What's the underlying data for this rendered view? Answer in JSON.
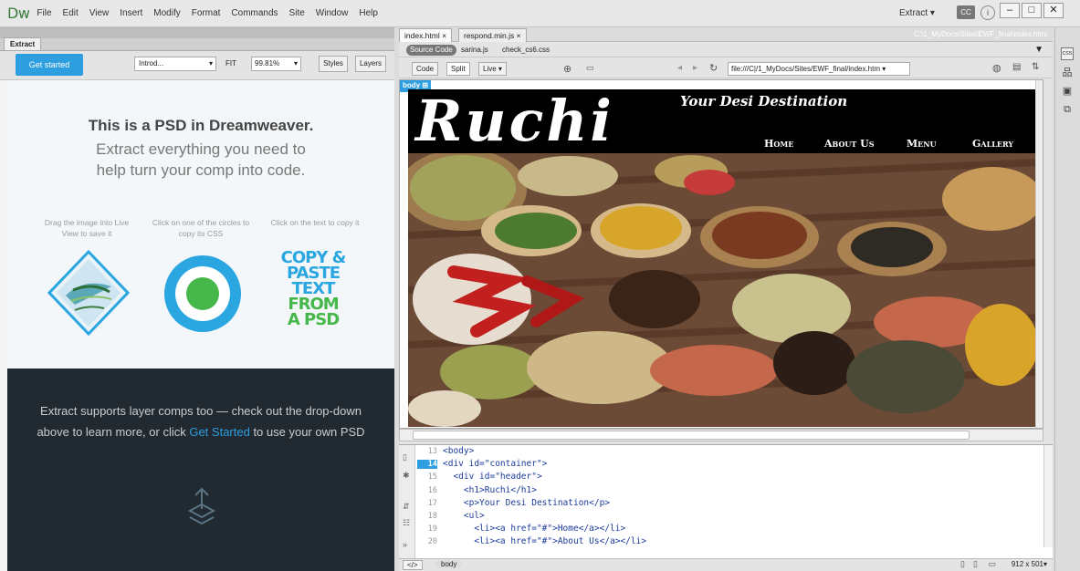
{
  "app": {
    "logo": "Dw"
  },
  "menu": [
    "File",
    "Edit",
    "View",
    "Insert",
    "Modify",
    "Format",
    "Commands",
    "Site",
    "Window",
    "Help"
  ],
  "workspace": {
    "label": "Extract",
    "caret": "▾"
  },
  "window_controls": {
    "minimize": "–",
    "maximize": "□",
    "close": "✕"
  },
  "extract_panel": {
    "tab": "Extract",
    "get_started": "Get started",
    "comp_select": "Introd...",
    "fit_label": "FIT",
    "fit_value": "99.81%",
    "styles": "Styles",
    "layers": "Layers",
    "headline": "This is a PSD in Dreamweaver.",
    "subline": "Extract everything you need to help turn your comp into code.",
    "tips": [
      "Drag the image into Live View to save it",
      "Click on one of the circles to copy its CSS",
      "Click on the text to copy it"
    ],
    "copy_paste_art": [
      "COPY &",
      "PASTE",
      "TEXT",
      "FROM",
      "A PSD"
    ],
    "dark_text": "Extract supports layer comps too — check out the drop-down above to learn more, or click ",
    "dark_link": "Get Started",
    "dark_text_end": " to use your own PSD"
  },
  "document": {
    "tabs": [
      "index.html",
      "respond.min.js"
    ],
    "path": "C:\\1_MyDocs\\Sites\\EWF_final\\index.html",
    "source_code": "Source Code",
    "related_files": [
      "sarina.js",
      "check_cs6.css"
    ],
    "view_buttons": [
      "Code",
      "Split",
      "Live"
    ],
    "url": "file:///C|/1_MyDocs/Sites/EWF_final/index.htm",
    "body_tag": "body"
  },
  "site_preview": {
    "logo": "Ruchi",
    "tagline": "Your Desi Destination",
    "nav": [
      "Home",
      "About Us",
      "Menu",
      "Gallery"
    ]
  },
  "code": {
    "active_line": 14,
    "lines": [
      {
        "num": "13",
        "text": "<body>"
      },
      {
        "num": "14",
        "text": "<div id=\"container\">"
      },
      {
        "num": "15",
        "text": "  <div id=\"header\">"
      },
      {
        "num": "16",
        "text": "    <h1>Ruchi</h1>"
      },
      {
        "num": "17",
        "text": "    <p>Your Desi Destination</p>"
      },
      {
        "num": "18",
        "text": "    <ul>"
      },
      {
        "num": "19",
        "text": "      <li><a href=\"#\">Home</a></li>"
      },
      {
        "num": "20",
        "text": "      <li><a href=\"#\">About Us</a></li>"
      }
    ]
  },
  "status": {
    "tag_selector": "</>",
    "crumb": "body",
    "dimensions": "912 x 501▾"
  },
  "colors": {
    "accent": "#2d9ee0",
    "dark_panel": "#212a31",
    "copy_blue": "#2aa6e0",
    "copy_green": "#46b74a"
  }
}
